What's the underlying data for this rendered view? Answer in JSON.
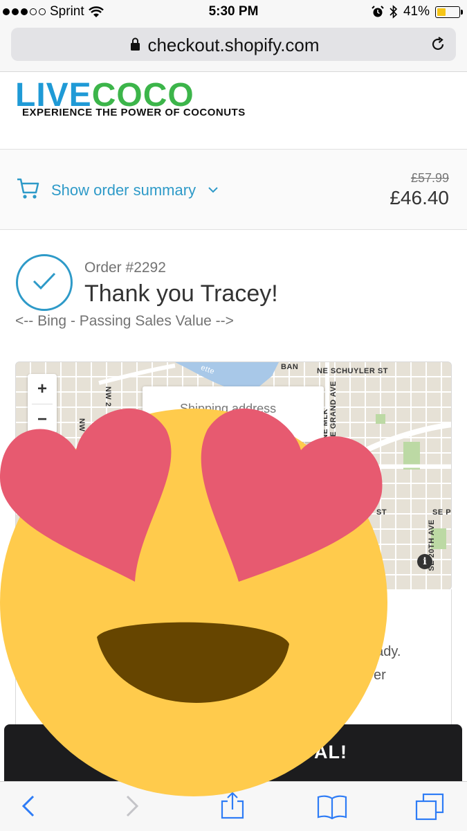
{
  "status_bar": {
    "carrier": "Sprint",
    "time": "5:30 PM",
    "battery": "41%",
    "battery_level": 0.41
  },
  "browser": {
    "url": "checkout.shopify.com"
  },
  "brand": {
    "logo_live": "LIVE",
    "logo_coco": "COCO",
    "tagline": "EXPERIENCE THE POWER OF COCONUTS",
    "colors": {
      "live": "#1f9ad6",
      "coco": "#3cb54a",
      "accent": "#2e9ac8"
    }
  },
  "order_summary": {
    "toggle_label": "Show order summary",
    "original_price": "£57.99",
    "total": "£46.40"
  },
  "order": {
    "number": "Order #2292",
    "thank_you": "Thank you Tracey!",
    "comment": "<-- Bing - Passing Sales Value -->"
  },
  "map": {
    "zoom_in": "+",
    "zoom_out": "−",
    "popup": "Shipping address",
    "streets": [
      "NE SCHUYLER ST",
      "NE MLK",
      "NE GRAND AVE",
      "NW 2",
      "NW",
      "SE P",
      "ST",
      "SE 20TH AVE",
      "BAN",
      "ette"
    ],
    "info": "i"
  },
  "partial_text": {
    "line1": "eady.",
    "line2": "er"
  },
  "banner": {
    "text": "AL!"
  },
  "toolbar": {
    "icons": [
      "back-icon",
      "forward-icon",
      "share-icon",
      "bookmarks-icon",
      "tabs-icon"
    ]
  },
  "overlay": {
    "icon": "heart-eyes-emoji-icon"
  }
}
